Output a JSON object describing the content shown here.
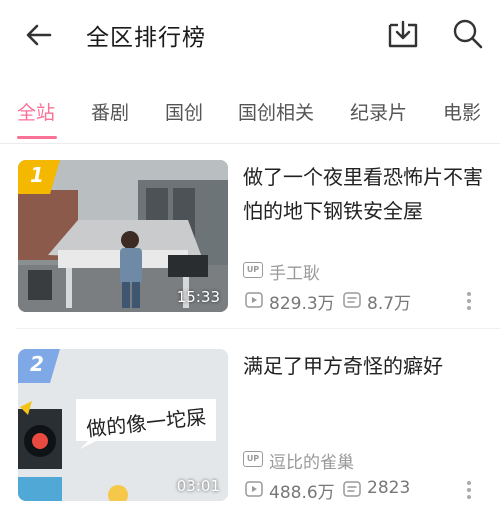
{
  "header": {
    "title": "全区排行榜",
    "icons": [
      "back-arrow-icon",
      "download-icon",
      "search-icon"
    ]
  },
  "tabs": [
    {
      "label": "全站",
      "active": true
    },
    {
      "label": "番剧",
      "active": false
    },
    {
      "label": "国创",
      "active": false
    },
    {
      "label": "国创相关",
      "active": false
    },
    {
      "label": "纪录片",
      "active": false
    },
    {
      "label": "电影",
      "active": false
    }
  ],
  "colors": {
    "accent": "#fb7299",
    "rank1": "#f5b800",
    "rank2": "#7fa9e6"
  },
  "videos": [
    {
      "rank": "1",
      "title": "做了一个夜里看恐怖片不害怕的地下钢铁安全屋",
      "duration": "15:33",
      "author_badge": "UP",
      "author": "手工耿",
      "views": "829.3万",
      "danmaku": "8.7万"
    },
    {
      "rank": "2",
      "title": "满足了甲方奇怪的癖好",
      "thumb_caption": "做的像一坨屎",
      "duration": "03:01",
      "author_badge": "UP",
      "author": "逗比的雀巢",
      "views": "488.6万",
      "danmaku": "2823"
    }
  ]
}
